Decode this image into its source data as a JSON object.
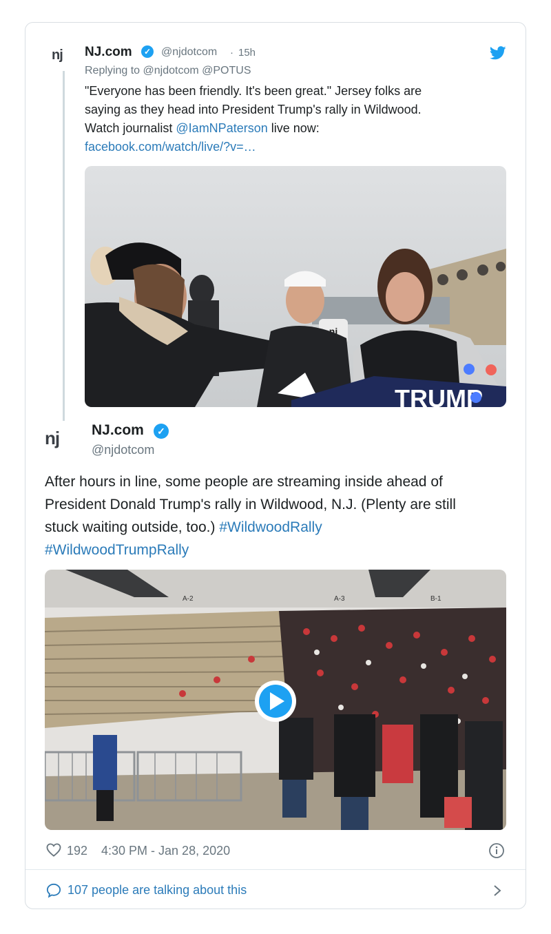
{
  "quoted_tweet": {
    "logo_text": "nj",
    "name": "NJ.com",
    "handle": "@njdotcom",
    "dot": "·",
    "time": "15h",
    "reply_prefix": "Replying to",
    "reply_to_1": "@njdotcom",
    "reply_to_2": "@POTUS",
    "text_line_1": "\"Everyone has been friendly. It's been great.\" Jersey folks are",
    "text_line_2": "saying as they head into President Trump's rally in Wildwood.",
    "text_line_3_prefix": "Watch journalist",
    "mention": "@IamNPaterson",
    "text_line_3_suffix": "live now:",
    "url": "facebook.com/watch/live/?v=…",
    "sign_text": "TRUMP"
  },
  "main_tweet": {
    "logo_text": "nj",
    "name": "NJ.com",
    "handle": "@njdotcom",
    "body_line_1": "After hours in line, some people are streaming inside ahead of",
    "body_line_2": "President Donald Trump's rally in Wildwood, N.J. (Plenty are still",
    "body_line_3_prefix": "stuck waiting outside, too.)",
    "hashtag_1": "#WildwoodRally",
    "hashtag_2": "#WildwoodTrumpRally",
    "sections": [
      "A-2",
      "A-3",
      "B-1"
    ],
    "likes": "192",
    "timestamp": "4:30 PM - Jan 28, 2020",
    "conversation": "107 people are talking about this"
  },
  "colors": {
    "accent": "#1da1f2",
    "link": "#2b7bb9",
    "text": "#1c2022",
    "muted": "#69767f"
  },
  "icons": [
    "twitter-bird-icon",
    "verified-badge-icon",
    "heart-icon",
    "info-icon",
    "speech-bubble-icon",
    "chevron-right-icon",
    "play-icon"
  ]
}
